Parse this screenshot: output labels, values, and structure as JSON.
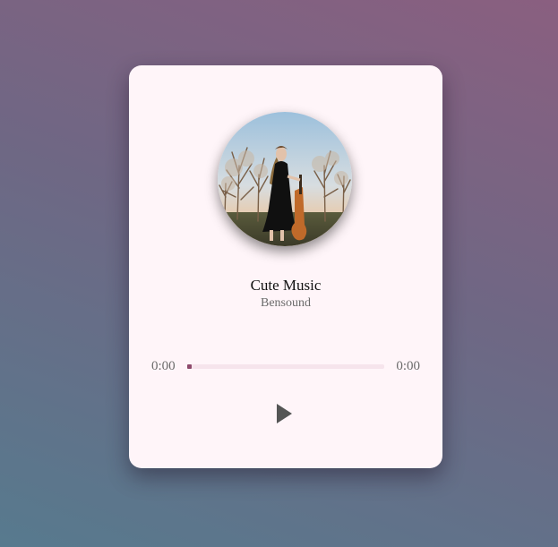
{
  "player": {
    "title": "Cute Music",
    "artist": "Bensound",
    "current_time": "0:00",
    "total_time": "0:00",
    "progress_fraction": 0,
    "cover_icon": "album-cover-image",
    "play_icon": "play-icon"
  },
  "colors": {
    "card_background": "#fff5f9",
    "progress_fill": "#8e4a6c",
    "progress_track": "#f6e4ec",
    "play_icon": "#555555"
  }
}
